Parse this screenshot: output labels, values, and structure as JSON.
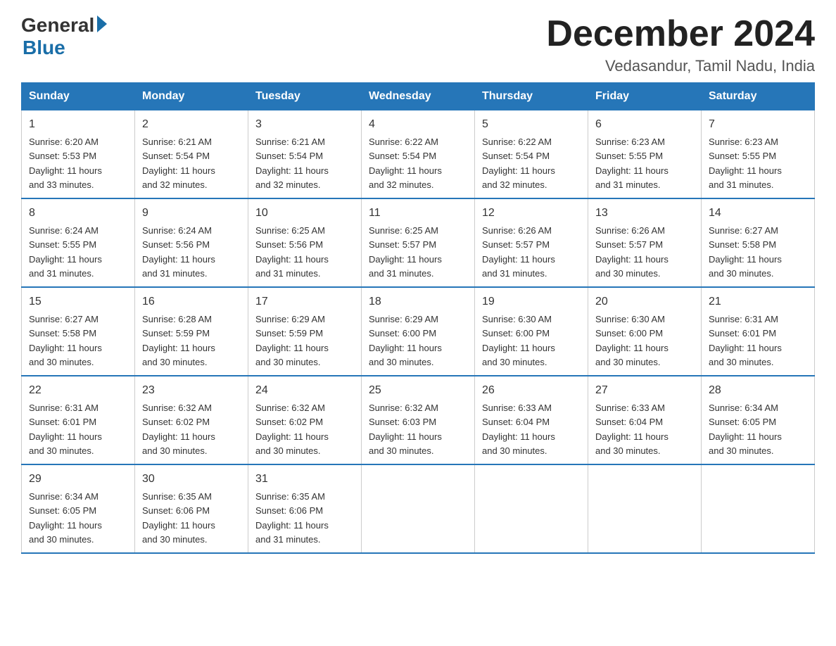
{
  "logo": {
    "general": "General",
    "blue": "Blue",
    "subtitle": "Blue"
  },
  "header": {
    "title": "December 2024",
    "location": "Vedasandur, Tamil Nadu, India"
  },
  "days_of_week": [
    "Sunday",
    "Monday",
    "Tuesday",
    "Wednesday",
    "Thursday",
    "Friday",
    "Saturday"
  ],
  "weeks": [
    [
      {
        "day": "1",
        "sunrise": "6:20 AM",
        "sunset": "5:53 PM",
        "daylight": "11 hours and 33 minutes."
      },
      {
        "day": "2",
        "sunrise": "6:21 AM",
        "sunset": "5:54 PM",
        "daylight": "11 hours and 32 minutes."
      },
      {
        "day": "3",
        "sunrise": "6:21 AM",
        "sunset": "5:54 PM",
        "daylight": "11 hours and 32 minutes."
      },
      {
        "day": "4",
        "sunrise": "6:22 AM",
        "sunset": "5:54 PM",
        "daylight": "11 hours and 32 minutes."
      },
      {
        "day": "5",
        "sunrise": "6:22 AM",
        "sunset": "5:54 PM",
        "daylight": "11 hours and 32 minutes."
      },
      {
        "day": "6",
        "sunrise": "6:23 AM",
        "sunset": "5:55 PM",
        "daylight": "11 hours and 31 minutes."
      },
      {
        "day": "7",
        "sunrise": "6:23 AM",
        "sunset": "5:55 PM",
        "daylight": "11 hours and 31 minutes."
      }
    ],
    [
      {
        "day": "8",
        "sunrise": "6:24 AM",
        "sunset": "5:55 PM",
        "daylight": "11 hours and 31 minutes."
      },
      {
        "day": "9",
        "sunrise": "6:24 AM",
        "sunset": "5:56 PM",
        "daylight": "11 hours and 31 minutes."
      },
      {
        "day": "10",
        "sunrise": "6:25 AM",
        "sunset": "5:56 PM",
        "daylight": "11 hours and 31 minutes."
      },
      {
        "day": "11",
        "sunrise": "6:25 AM",
        "sunset": "5:57 PM",
        "daylight": "11 hours and 31 minutes."
      },
      {
        "day": "12",
        "sunrise": "6:26 AM",
        "sunset": "5:57 PM",
        "daylight": "11 hours and 31 minutes."
      },
      {
        "day": "13",
        "sunrise": "6:26 AM",
        "sunset": "5:57 PM",
        "daylight": "11 hours and 30 minutes."
      },
      {
        "day": "14",
        "sunrise": "6:27 AM",
        "sunset": "5:58 PM",
        "daylight": "11 hours and 30 minutes."
      }
    ],
    [
      {
        "day": "15",
        "sunrise": "6:27 AM",
        "sunset": "5:58 PM",
        "daylight": "11 hours and 30 minutes."
      },
      {
        "day": "16",
        "sunrise": "6:28 AM",
        "sunset": "5:59 PM",
        "daylight": "11 hours and 30 minutes."
      },
      {
        "day": "17",
        "sunrise": "6:29 AM",
        "sunset": "5:59 PM",
        "daylight": "11 hours and 30 minutes."
      },
      {
        "day": "18",
        "sunrise": "6:29 AM",
        "sunset": "6:00 PM",
        "daylight": "11 hours and 30 minutes."
      },
      {
        "day": "19",
        "sunrise": "6:30 AM",
        "sunset": "6:00 PM",
        "daylight": "11 hours and 30 minutes."
      },
      {
        "day": "20",
        "sunrise": "6:30 AM",
        "sunset": "6:00 PM",
        "daylight": "11 hours and 30 minutes."
      },
      {
        "day": "21",
        "sunrise": "6:31 AM",
        "sunset": "6:01 PM",
        "daylight": "11 hours and 30 minutes."
      }
    ],
    [
      {
        "day": "22",
        "sunrise": "6:31 AM",
        "sunset": "6:01 PM",
        "daylight": "11 hours and 30 minutes."
      },
      {
        "day": "23",
        "sunrise": "6:32 AM",
        "sunset": "6:02 PM",
        "daylight": "11 hours and 30 minutes."
      },
      {
        "day": "24",
        "sunrise": "6:32 AM",
        "sunset": "6:02 PM",
        "daylight": "11 hours and 30 minutes."
      },
      {
        "day": "25",
        "sunrise": "6:32 AM",
        "sunset": "6:03 PM",
        "daylight": "11 hours and 30 minutes."
      },
      {
        "day": "26",
        "sunrise": "6:33 AM",
        "sunset": "6:04 PM",
        "daylight": "11 hours and 30 minutes."
      },
      {
        "day": "27",
        "sunrise": "6:33 AM",
        "sunset": "6:04 PM",
        "daylight": "11 hours and 30 minutes."
      },
      {
        "day": "28",
        "sunrise": "6:34 AM",
        "sunset": "6:05 PM",
        "daylight": "11 hours and 30 minutes."
      }
    ],
    [
      {
        "day": "29",
        "sunrise": "6:34 AM",
        "sunset": "6:05 PM",
        "daylight": "11 hours and 30 minutes."
      },
      {
        "day": "30",
        "sunrise": "6:35 AM",
        "sunset": "6:06 PM",
        "daylight": "11 hours and 30 minutes."
      },
      {
        "day": "31",
        "sunrise": "6:35 AM",
        "sunset": "6:06 PM",
        "daylight": "11 hours and 31 minutes."
      },
      null,
      null,
      null,
      null
    ]
  ],
  "labels": {
    "sunrise": "Sunrise:",
    "sunset": "Sunset:",
    "daylight": "Daylight:"
  }
}
